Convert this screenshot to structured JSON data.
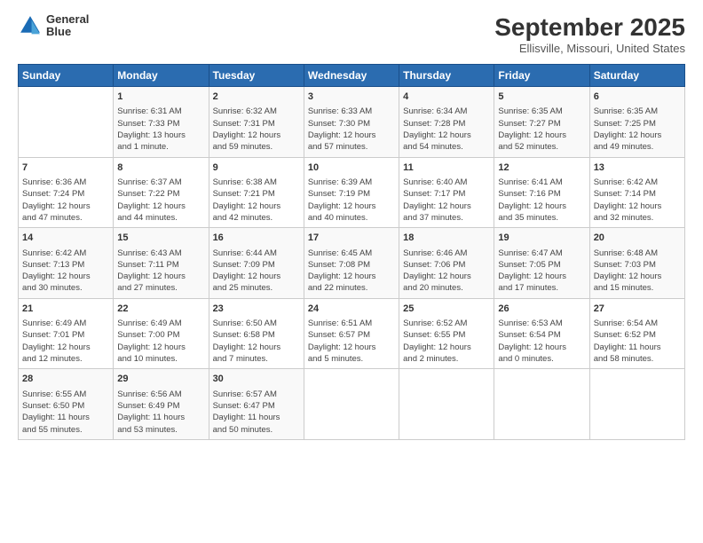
{
  "header": {
    "logo_line1": "General",
    "logo_line2": "Blue",
    "title": "September 2025",
    "subtitle": "Ellisville, Missouri, United States"
  },
  "days_of_week": [
    "Sunday",
    "Monday",
    "Tuesday",
    "Wednesday",
    "Thursday",
    "Friday",
    "Saturday"
  ],
  "weeks": [
    [
      {
        "day": "",
        "info": ""
      },
      {
        "day": "1",
        "info": "Sunrise: 6:31 AM\nSunset: 7:33 PM\nDaylight: 13 hours\nand 1 minute."
      },
      {
        "day": "2",
        "info": "Sunrise: 6:32 AM\nSunset: 7:31 PM\nDaylight: 12 hours\nand 59 minutes."
      },
      {
        "day": "3",
        "info": "Sunrise: 6:33 AM\nSunset: 7:30 PM\nDaylight: 12 hours\nand 57 minutes."
      },
      {
        "day": "4",
        "info": "Sunrise: 6:34 AM\nSunset: 7:28 PM\nDaylight: 12 hours\nand 54 minutes."
      },
      {
        "day": "5",
        "info": "Sunrise: 6:35 AM\nSunset: 7:27 PM\nDaylight: 12 hours\nand 52 minutes."
      },
      {
        "day": "6",
        "info": "Sunrise: 6:35 AM\nSunset: 7:25 PM\nDaylight: 12 hours\nand 49 minutes."
      }
    ],
    [
      {
        "day": "7",
        "info": "Sunrise: 6:36 AM\nSunset: 7:24 PM\nDaylight: 12 hours\nand 47 minutes."
      },
      {
        "day": "8",
        "info": "Sunrise: 6:37 AM\nSunset: 7:22 PM\nDaylight: 12 hours\nand 44 minutes."
      },
      {
        "day": "9",
        "info": "Sunrise: 6:38 AM\nSunset: 7:21 PM\nDaylight: 12 hours\nand 42 minutes."
      },
      {
        "day": "10",
        "info": "Sunrise: 6:39 AM\nSunset: 7:19 PM\nDaylight: 12 hours\nand 40 minutes."
      },
      {
        "day": "11",
        "info": "Sunrise: 6:40 AM\nSunset: 7:17 PM\nDaylight: 12 hours\nand 37 minutes."
      },
      {
        "day": "12",
        "info": "Sunrise: 6:41 AM\nSunset: 7:16 PM\nDaylight: 12 hours\nand 35 minutes."
      },
      {
        "day": "13",
        "info": "Sunrise: 6:42 AM\nSunset: 7:14 PM\nDaylight: 12 hours\nand 32 minutes."
      }
    ],
    [
      {
        "day": "14",
        "info": "Sunrise: 6:42 AM\nSunset: 7:13 PM\nDaylight: 12 hours\nand 30 minutes."
      },
      {
        "day": "15",
        "info": "Sunrise: 6:43 AM\nSunset: 7:11 PM\nDaylight: 12 hours\nand 27 minutes."
      },
      {
        "day": "16",
        "info": "Sunrise: 6:44 AM\nSunset: 7:09 PM\nDaylight: 12 hours\nand 25 minutes."
      },
      {
        "day": "17",
        "info": "Sunrise: 6:45 AM\nSunset: 7:08 PM\nDaylight: 12 hours\nand 22 minutes."
      },
      {
        "day": "18",
        "info": "Sunrise: 6:46 AM\nSunset: 7:06 PM\nDaylight: 12 hours\nand 20 minutes."
      },
      {
        "day": "19",
        "info": "Sunrise: 6:47 AM\nSunset: 7:05 PM\nDaylight: 12 hours\nand 17 minutes."
      },
      {
        "day": "20",
        "info": "Sunrise: 6:48 AM\nSunset: 7:03 PM\nDaylight: 12 hours\nand 15 minutes."
      }
    ],
    [
      {
        "day": "21",
        "info": "Sunrise: 6:49 AM\nSunset: 7:01 PM\nDaylight: 12 hours\nand 12 minutes."
      },
      {
        "day": "22",
        "info": "Sunrise: 6:49 AM\nSunset: 7:00 PM\nDaylight: 12 hours\nand 10 minutes."
      },
      {
        "day": "23",
        "info": "Sunrise: 6:50 AM\nSunset: 6:58 PM\nDaylight: 12 hours\nand 7 minutes."
      },
      {
        "day": "24",
        "info": "Sunrise: 6:51 AM\nSunset: 6:57 PM\nDaylight: 12 hours\nand 5 minutes."
      },
      {
        "day": "25",
        "info": "Sunrise: 6:52 AM\nSunset: 6:55 PM\nDaylight: 12 hours\nand 2 minutes."
      },
      {
        "day": "26",
        "info": "Sunrise: 6:53 AM\nSunset: 6:54 PM\nDaylight: 12 hours\nand 0 minutes."
      },
      {
        "day": "27",
        "info": "Sunrise: 6:54 AM\nSunset: 6:52 PM\nDaylight: 11 hours\nand 58 minutes."
      }
    ],
    [
      {
        "day": "28",
        "info": "Sunrise: 6:55 AM\nSunset: 6:50 PM\nDaylight: 11 hours\nand 55 minutes."
      },
      {
        "day": "29",
        "info": "Sunrise: 6:56 AM\nSunset: 6:49 PM\nDaylight: 11 hours\nand 53 minutes."
      },
      {
        "day": "30",
        "info": "Sunrise: 6:57 AM\nSunset: 6:47 PM\nDaylight: 11 hours\nand 50 minutes."
      },
      {
        "day": "",
        "info": ""
      },
      {
        "day": "",
        "info": ""
      },
      {
        "day": "",
        "info": ""
      },
      {
        "day": "",
        "info": ""
      }
    ]
  ]
}
